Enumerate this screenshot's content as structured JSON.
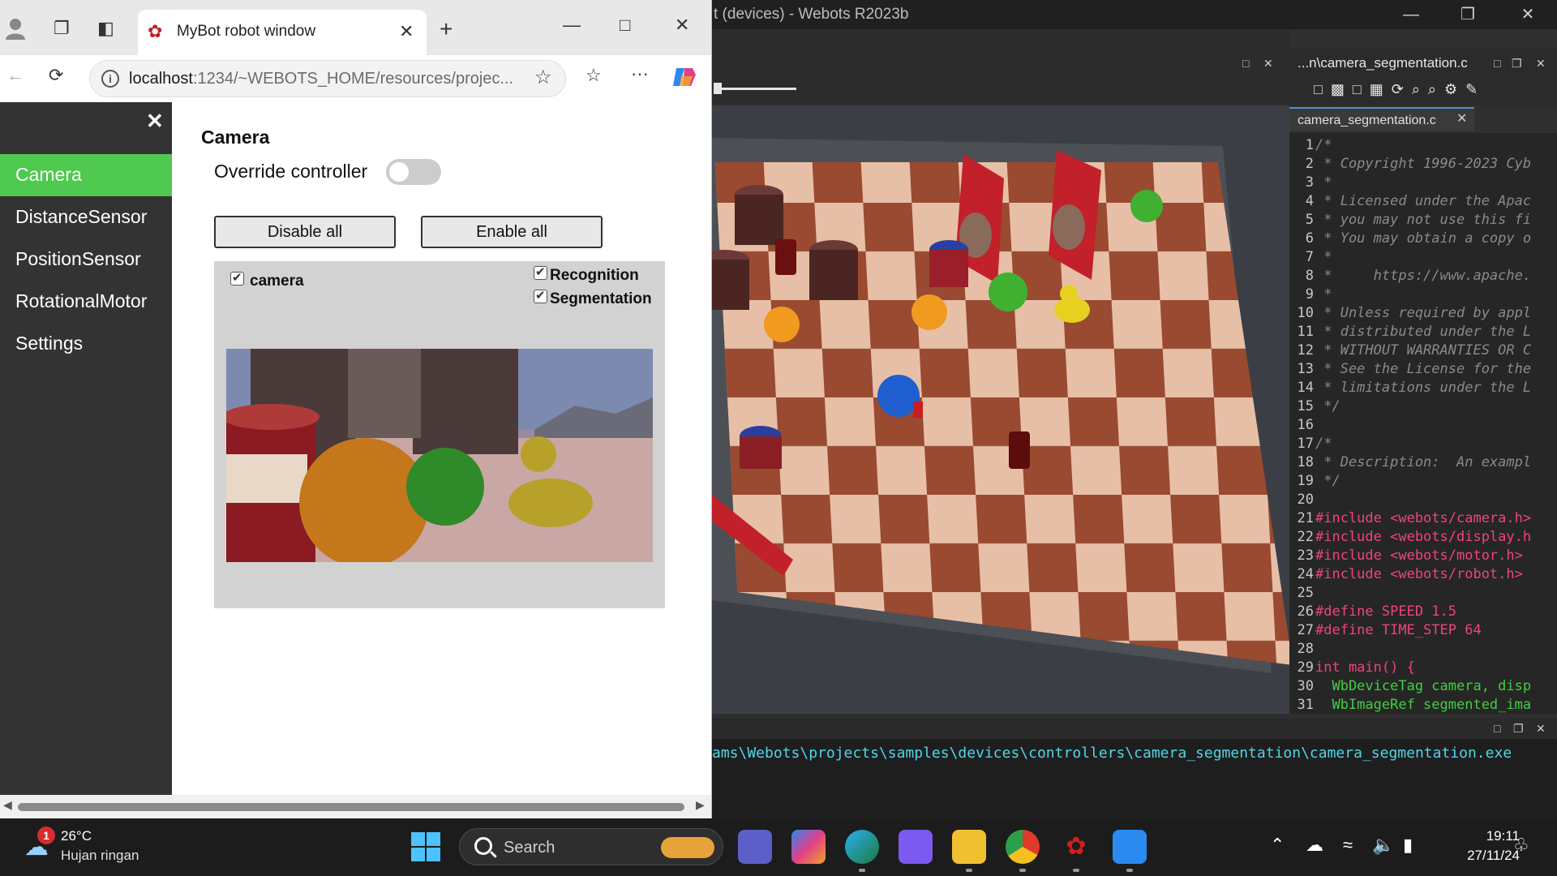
{
  "webots": {
    "title": "t (devices) - Webots R2023b",
    "editor_filename": "...n\\camera_segmentation.c",
    "editor_tab": "camera_segmentation.c",
    "code_lines": [
      {
        "n": "1",
        "t": "/*",
        "k": "tx"
      },
      {
        "n": "2",
        "t": " * Copyright 1996-2023 Cyb",
        "k": "tx"
      },
      {
        "n": "3",
        "t": " *",
        "k": "tx"
      },
      {
        "n": "4",
        "t": " * Licensed under the Apac",
        "k": "tx"
      },
      {
        "n": "5",
        "t": " * you may not use this fi",
        "k": "tx"
      },
      {
        "n": "6",
        "t": " * You may obtain a copy o",
        "k": "tx"
      },
      {
        "n": "7",
        "t": " *",
        "k": "tx"
      },
      {
        "n": "8",
        "t": " *     https://www.apache.",
        "k": "tx"
      },
      {
        "n": "9",
        "t": " *",
        "k": "tx"
      },
      {
        "n": "10",
        "t": " * Unless required by appl",
        "k": "tx"
      },
      {
        "n": "11",
        "t": " * distributed under the L",
        "k": "tx"
      },
      {
        "n": "12",
        "t": " * WITHOUT WARRANTIES OR C",
        "k": "tx"
      },
      {
        "n": "13",
        "t": " * See the License for the",
        "k": "tx"
      },
      {
        "n": "14",
        "t": " * limitations under the L",
        "k": "tx"
      },
      {
        "n": "15",
        "t": " */",
        "k": "tx"
      },
      {
        "n": "16",
        "t": "",
        "k": "tx"
      },
      {
        "n": "17",
        "t": "/*",
        "k": "tx"
      },
      {
        "n": "18",
        "t": " * Description:  An exampl",
        "k": "tx"
      },
      {
        "n": "19",
        "t": " */",
        "k": "tx"
      },
      {
        "n": "20",
        "t": "",
        "k": "tx"
      },
      {
        "n": "21",
        "t": "#include <webots/camera.h>",
        "k": "pp"
      },
      {
        "n": "22",
        "t": "#include <webots/display.h",
        "k": "pp"
      },
      {
        "n": "23",
        "t": "#include <webots/motor.h>",
        "k": "pp"
      },
      {
        "n": "24",
        "t": "#include <webots/robot.h>",
        "k": "pp"
      },
      {
        "n": "25",
        "t": "",
        "k": "tx"
      },
      {
        "n": "26",
        "t": "#define SPEED 1.5",
        "k": "pp"
      },
      {
        "n": "27",
        "t": "#define TIME_STEP 64",
        "k": "pp"
      },
      {
        "n": "28",
        "t": "",
        "k": "tx"
      },
      {
        "n": "29",
        "t": "int main() {",
        "k": "kw"
      },
      {
        "n": "30",
        "t": "  WbDeviceTag camera, disp",
        "k": "ty"
      },
      {
        "n": "31",
        "t": "  WbImageRef segmented_ima",
        "k": "ty"
      }
    ],
    "console_text": "ams\\Webots\\projects\\samples\\devices\\controllers\\camera_segmentation\\camera_segmentation.exe"
  },
  "browser": {
    "tab_title": "MyBot robot window",
    "url_host": "localhost",
    "url_rest": ":1234/~WEBOTS_HOME/resources/projec..."
  },
  "robot_window": {
    "sidebar": [
      {
        "label": "Camera",
        "active": true
      },
      {
        "label": "DistanceSensor",
        "active": false
      },
      {
        "label": "PositionSensor",
        "active": false
      },
      {
        "label": "RotationalMotor",
        "active": false
      },
      {
        "label": "Settings",
        "active": false
      }
    ],
    "title": "Camera",
    "override_label": "Override controller",
    "override_enabled": false,
    "disable_all": "Disable all",
    "enable_all": "Enable all",
    "device_name": "camera",
    "recognition": "Recognition",
    "segmentation": "Segmentation"
  },
  "taskbar": {
    "notification_count": "1",
    "temperature": "26°C",
    "weather": "Hujan ringan",
    "search_label": "Search",
    "time": "19:11",
    "date": "27/11/24"
  }
}
